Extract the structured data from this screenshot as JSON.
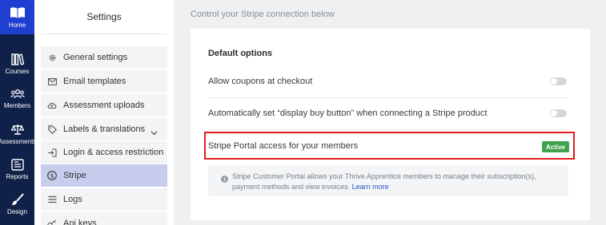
{
  "rail": {
    "home_label": "Home",
    "items": [
      {
        "label": "Courses",
        "icon": "books-icon"
      },
      {
        "label": "Members",
        "icon": "members-icon"
      },
      {
        "label": "Assessments",
        "icon": "scales-icon"
      },
      {
        "label": "Reports",
        "icon": "reports-icon"
      },
      {
        "label": "Design",
        "icon": "brush-icon"
      }
    ]
  },
  "sidebar": {
    "title": "Settings",
    "items": [
      {
        "label": "General settings",
        "icon": "gear-icon"
      },
      {
        "label": "Email templates",
        "icon": "email-icon"
      },
      {
        "label": "Assessment uploads",
        "icon": "cloud-upload-icon"
      },
      {
        "label": "Labels & translations",
        "icon": "tag-icon",
        "expandable": true
      },
      {
        "label": "Login & access restriction",
        "icon": "login-icon"
      },
      {
        "label": "Stripe",
        "icon": "dollar-icon",
        "active": true
      },
      {
        "label": "Logs",
        "icon": "list-icon"
      },
      {
        "label": "Api keys",
        "icon": "key-icon"
      }
    ]
  },
  "main": {
    "subtitle": "Control your Stripe connection below",
    "section_title": "Default options",
    "rows": [
      {
        "label": "Allow coupons at checkout",
        "toggle": false
      },
      {
        "label": "Automatically set “display buy button” when connecting a Stripe product",
        "toggle": false
      },
      {
        "label": "Stripe Portal access for your members",
        "badge": "Active"
      }
    ],
    "info": {
      "text": "Stripe Customer Portal allows your Thrive Apprentice members to manage their subscription(s), payment methods and view invoices.",
      "link": "Learn more"
    }
  },
  "colors": {
    "rail": "#0f2148",
    "home": "#1e3fd0",
    "active_item": "#c8cdee",
    "badge": "#3fa34d",
    "highlight": "#e11d1d",
    "link": "#2456c8"
  }
}
